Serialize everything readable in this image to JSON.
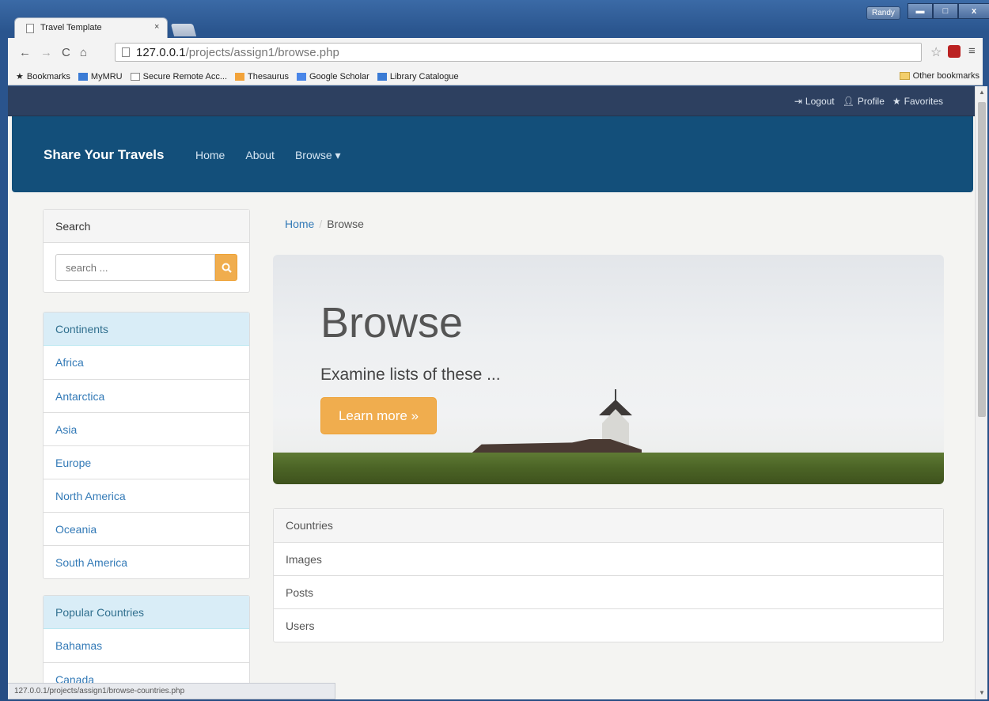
{
  "browser": {
    "user_badge": "Randy",
    "minimize": "▬",
    "maximize": "□",
    "close": "x",
    "tab_title": "Travel Template",
    "tab_close": "×",
    "url_host": "127.0.0.1",
    "url_path": "/projects/assign1/browse.php",
    "bookmarks": [
      "Bookmarks",
      "MyMRU",
      "Secure Remote Acc...",
      "Thesaurus",
      "Google Scholar",
      "Library Catalogue"
    ],
    "other_bookmarks": "Other bookmarks",
    "status_url": "127.0.0.1/projects/assign1/browse-countries.php"
  },
  "topbar": {
    "logout": "Logout",
    "profile": "Profile",
    "favorites": "Favorites"
  },
  "navbar": {
    "brand": "Share Your Travels",
    "home": "Home",
    "about": "About",
    "browse": "Browse ▾"
  },
  "sidebar": {
    "search_heading": "Search",
    "search_placeholder": "search ...",
    "continents_heading": "Continents",
    "continents": [
      "Africa",
      "Antarctica",
      "Asia",
      "Europe",
      "North America",
      "Oceania",
      "South America"
    ],
    "popular_heading": "Popular Countries",
    "popular": [
      "Bahamas",
      "Canada"
    ]
  },
  "breadcrumb": {
    "home": "Home",
    "sep": "/",
    "current": "Browse"
  },
  "jumbotron": {
    "title": "Browse",
    "subtitle": "Examine lists of these ...",
    "button": "Learn more »"
  },
  "browse_list": [
    "Countries",
    "Images",
    "Posts",
    "Users"
  ],
  "colors": {
    "navbar": "#134f7a",
    "accent": "#f0ad4e",
    "link": "#337ab7"
  }
}
